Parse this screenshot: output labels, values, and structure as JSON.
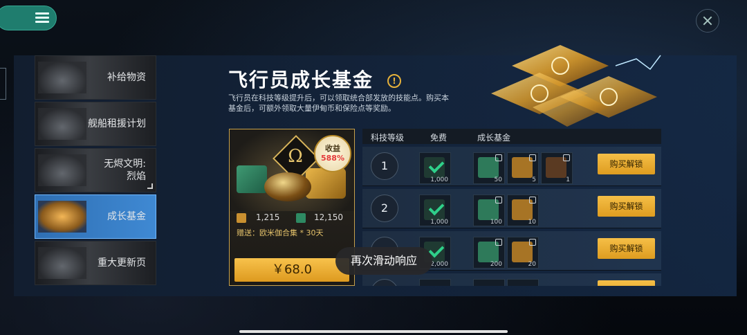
{
  "sidebar": {
    "items": [
      {
        "label": "补给物资",
        "active": false
      },
      {
        "label": "舰船租援计划",
        "active": false
      },
      {
        "label": "无烬文明:\n烈焰",
        "active": false
      },
      {
        "label": "成长基金",
        "active": true
      },
      {
        "label": "重大更新页",
        "active": false
      }
    ]
  },
  "header": {
    "title": "飞行员成长基金",
    "info_icon": "!",
    "description": "飞行员在科技等级提升后，可以领取统合部发放的技能点。购买本基金后，可额外领取大量伊甸币和保险点等奖励。"
  },
  "card": {
    "badge_label": "收益",
    "badge_value": "588%",
    "stat1": "1,215",
    "stat2": "12,150",
    "gift": "赠送：欧米伽合集 * 30天",
    "price": "￥68.0"
  },
  "table": {
    "col_level": "科技等级",
    "col_free": "免费",
    "col_fund": "成长基金",
    "rows": [
      {
        "level": "1",
        "free_count": "1,000",
        "fund": [
          "50",
          "5",
          "1"
        ],
        "buy": "购买解锁"
      },
      {
        "level": "2",
        "free_count": "1,000",
        "fund": [
          "100",
          "10"
        ],
        "buy": "购买解锁"
      },
      {
        "level": "",
        "free_count": "2,000",
        "fund": [
          "200",
          "20"
        ],
        "buy": "购买解锁"
      }
    ]
  },
  "toast": "再次滑动响应",
  "colors": {
    "accent_gold": "#f5bf47",
    "active_tab": "#3f89d3",
    "menu_teal": "#1f7d6e"
  }
}
